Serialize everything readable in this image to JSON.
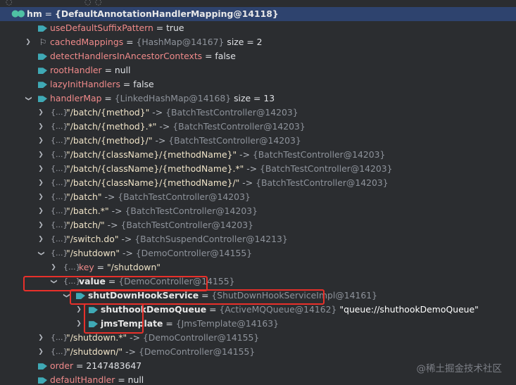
{
  "rows": [
    {
      "indent": 0,
      "arrow": "expanded",
      "icon": "watch",
      "name": "hm",
      "eq": " = ",
      "ref": "{DefaultAnnotationHandlerMapping@14118}",
      "nameStyle": "white",
      "refStyle": "white",
      "selected": true
    },
    {
      "indent": 1,
      "arrow": "",
      "icon": "field",
      "name": "useDefaultSuffixPattern",
      "eq": " = ",
      "val": "true"
    },
    {
      "indent": 1,
      "arrow": "collapsed",
      "icon": "flag",
      "name": "cachedMappings",
      "eq": " = ",
      "ref": "{HashMap@14167}",
      "val": "  size = 2"
    },
    {
      "indent": 1,
      "arrow": "",
      "icon": "field",
      "name": "detectHandlersInAncestorContexts",
      "eq": " = ",
      "val": "false"
    },
    {
      "indent": 1,
      "arrow": "",
      "icon": "field",
      "name": "rootHandler",
      "eq": " = ",
      "val": "null"
    },
    {
      "indent": 1,
      "arrow": "",
      "icon": "field",
      "name": "lazyInitHandlers",
      "eq": " = ",
      "val": "false"
    },
    {
      "indent": 1,
      "arrow": "expanded",
      "icon": "field",
      "name": "handlerMap",
      "eq": " = ",
      "ref": "{LinkedHashMap@14168}",
      "val": "  size = 13"
    },
    {
      "indent": 2,
      "arrow": "collapsed",
      "icon": "obj",
      "str": "\"/batch/{method}\"",
      "sep": " -> ",
      "ref": "{BatchTestController@14203}"
    },
    {
      "indent": 2,
      "arrow": "collapsed",
      "icon": "obj",
      "str": "\"/batch/{method}.*\"",
      "sep": " -> ",
      "ref": "{BatchTestController@14203}"
    },
    {
      "indent": 2,
      "arrow": "collapsed",
      "icon": "obj",
      "str": "\"/batch/{method}/\"",
      "sep": " -> ",
      "ref": "{BatchTestController@14203}"
    },
    {
      "indent": 2,
      "arrow": "collapsed",
      "icon": "obj",
      "str": "\"/batch/{className}/{methodName}\"",
      "sep": " -> ",
      "ref": "{BatchTestController@14203}"
    },
    {
      "indent": 2,
      "arrow": "collapsed",
      "icon": "obj",
      "str": "\"/batch/{className}/{methodName}.*\"",
      "sep": " -> ",
      "ref": "{BatchTestController@14203}"
    },
    {
      "indent": 2,
      "arrow": "collapsed",
      "icon": "obj",
      "str": "\"/batch/{className}/{methodName}/\"",
      "sep": " -> ",
      "ref": "{BatchTestController@14203}"
    },
    {
      "indent": 2,
      "arrow": "collapsed",
      "icon": "obj",
      "str": "\"/batch\"",
      "sep": " -> ",
      "ref": "{BatchTestController@14203}"
    },
    {
      "indent": 2,
      "arrow": "collapsed",
      "icon": "obj",
      "str": "\"/batch.*\"",
      "sep": " -> ",
      "ref": "{BatchTestController@14203}"
    },
    {
      "indent": 2,
      "arrow": "collapsed",
      "icon": "obj",
      "str": "\"/batch/\"",
      "sep": " -> ",
      "ref": "{BatchTestController@14203}"
    },
    {
      "indent": 2,
      "arrow": "collapsed",
      "icon": "obj",
      "str": "\"/switch.do\"",
      "sep": " -> ",
      "ref": "{BatchSuspendController@14213}"
    },
    {
      "indent": 2,
      "arrow": "expanded",
      "icon": "obj",
      "str": "\"/shutdown\"",
      "sep": " -> ",
      "ref": "{DemoController@14155}"
    },
    {
      "indent": 3,
      "arrow": "collapsed",
      "icon": "obj",
      "name": "key",
      "eq": " = ",
      "str": "\"/shutdown\""
    },
    {
      "indent": 3,
      "arrow": "expanded",
      "icon": "obj",
      "name": "value",
      "eq": " = ",
      "ref": "{DemoController@14155}",
      "nameStyle": "white"
    },
    {
      "indent": 4,
      "arrow": "expanded",
      "icon": "field",
      "name": "shutDownHookService",
      "eq": " = ",
      "ref": "{ShutDownHookServiceImpl@14161}",
      "nameStyle": "white"
    },
    {
      "indent": 5,
      "arrow": "collapsed",
      "icon": "field",
      "name": "shuthookDemoQueue",
      "eq": " = ",
      "ref": "{ActiveMQQueue@14162}",
      "strb": " \"queue://shuthookDemoQueue\"",
      "nameStyle": "white"
    },
    {
      "indent": 5,
      "arrow": "collapsed",
      "icon": "field",
      "name": "jmsTemplate",
      "eq": " = ",
      "ref": "{JmsTemplate@14163}",
      "nameStyle": "white"
    },
    {
      "indent": 2,
      "arrow": "collapsed",
      "icon": "obj",
      "str": "\"/shutdown.*\"",
      "sep": " -> ",
      "ref": "{DemoController@14155}"
    },
    {
      "indent": 2,
      "arrow": "collapsed",
      "icon": "obj",
      "str": "\"/shutdown/\"",
      "sep": " -> ",
      "ref": "{DemoController@14155}"
    },
    {
      "indent": 1,
      "arrow": "",
      "icon": "field",
      "name": "order",
      "eq": " = ",
      "val": "2147483647"
    },
    {
      "indent": 1,
      "arrow": "",
      "icon": "field",
      "name": "defaultHandler",
      "eq": " = ",
      "val": "null"
    }
  ],
  "obj_icon_glyph": "{...}",
  "watermark": "@稀土掘金技术社区",
  "colors": {
    "background": "#2b2d30",
    "selection": "#2e436e",
    "field_name": "#f08a8a",
    "reference": "#8e939b",
    "highlight_box": "#e8302a"
  }
}
